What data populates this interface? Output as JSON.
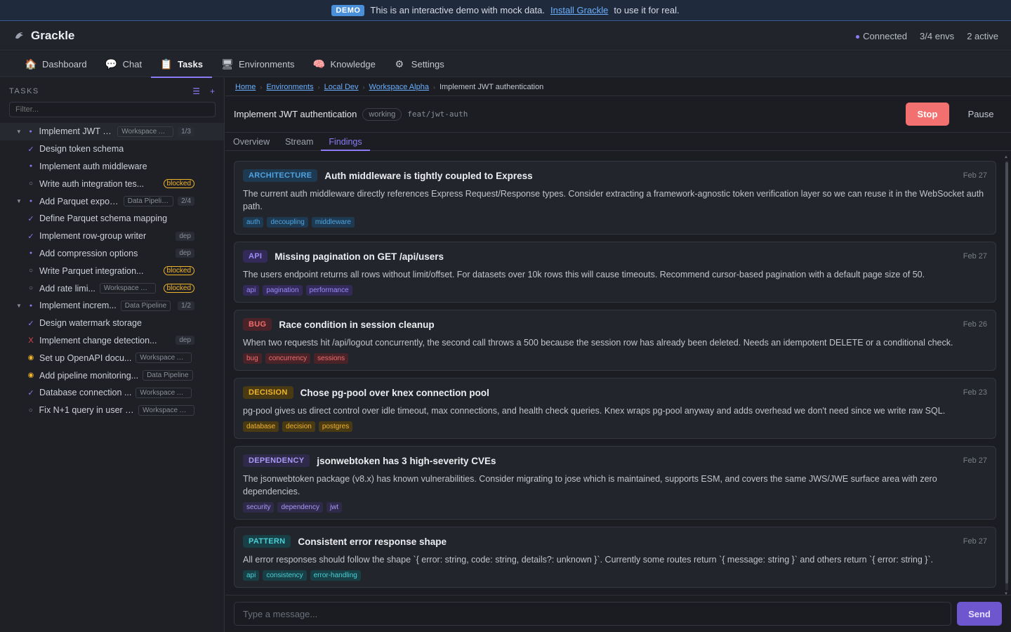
{
  "banner": {
    "badge": "DEMO",
    "text": "This is an interactive demo with mock data.",
    "link": "Install Grackle",
    "suffix": "to use it for real."
  },
  "header": {
    "app_name": "Grackle",
    "status": "Connected",
    "envs": "3/4 envs",
    "active": "2 active"
  },
  "nav": [
    {
      "label": "Dashboard",
      "icon": "house-icon",
      "glyph": "🏠"
    },
    {
      "label": "Chat",
      "icon": "chat-bubble-icon",
      "glyph": "💬"
    },
    {
      "label": "Tasks",
      "icon": "clipboard-icon",
      "glyph": "📋"
    },
    {
      "label": "Environments",
      "icon": "monitor-icon",
      "glyph": "🖥"
    },
    {
      "label": "Knowledge",
      "icon": "brain-icon",
      "glyph": "🧠"
    },
    {
      "label": "Settings",
      "icon": "gear-icon",
      "glyph": "⚙"
    }
  ],
  "sidebar": {
    "title": "TASKS",
    "filter_placeholder": "Filter...",
    "tasks": [
      {
        "label": "Implement JWT a...",
        "tag": "Workspace Al...",
        "count": "1/3",
        "status": "dot",
        "level": 0,
        "expanded": true,
        "selected": true
      },
      {
        "label": "Design token schema",
        "status": "check",
        "level": 1
      },
      {
        "label": "Implement auth middleware",
        "status": "dot",
        "level": 1
      },
      {
        "label": "Write auth integration tes...",
        "status": "circle",
        "level": 1,
        "blocked": "blocked"
      },
      {
        "label": "Add Parquet expor...",
        "tag": "Data Pipeline",
        "count": "2/4",
        "status": "dot",
        "level": 0,
        "expanded": true
      },
      {
        "label": "Define Parquet schema mapping",
        "status": "check",
        "level": 1
      },
      {
        "label": "Implement row-group writer",
        "status": "check",
        "level": 1,
        "dep": "dep"
      },
      {
        "label": "Add compression options",
        "status": "dot",
        "level": 1,
        "dep": "dep"
      },
      {
        "label": "Write Parquet integration...",
        "status": "circle",
        "level": 1,
        "blocked": "blocked"
      },
      {
        "label": "Add rate limi...",
        "tag": "Workspace Al...",
        "status": "circle",
        "level": 0,
        "blocked": "blocked"
      },
      {
        "label": "Implement increm...",
        "tag": "Data Pipeline",
        "count": "1/2",
        "status": "dot",
        "level": 0,
        "expanded": true
      },
      {
        "label": "Design watermark storage",
        "status": "check",
        "level": 1
      },
      {
        "label": "Implement change detection...",
        "status": "fail",
        "level": 1,
        "dep": "dep"
      },
      {
        "label": "Set up OpenAPI docu...",
        "tag": "Workspace Al...",
        "status": "warn",
        "level": 0
      },
      {
        "label": "Add pipeline monitoring...",
        "tag": "Data Pipeline",
        "status": "warn",
        "level": 0
      },
      {
        "label": "Database connection ...",
        "tag": "Workspace Al...",
        "status": "check",
        "level": 0
      },
      {
        "label": "Fix N+1 query in user li...",
        "tag": "Workspace Al...",
        "status": "circle",
        "level": 0
      }
    ]
  },
  "breadcrumbs": [
    "Home",
    "Environments",
    "Local Dev",
    "Workspace Alpha"
  ],
  "breadcrumb_current": "Implement JWT authentication",
  "task": {
    "title": "Implement JWT authentication",
    "state": "working",
    "branch": "feat/jwt-auth",
    "stop_label": "Stop",
    "pause_label": "Pause"
  },
  "subtabs": [
    "Overview",
    "Stream",
    "Findings"
  ],
  "findings": [
    {
      "category": "ARCHITECTURE",
      "color": "#4fa3e0",
      "bg": "#1e3a52",
      "title": "Auth middleware is tightly coupled to Express",
      "date": "Feb 27",
      "body": "The current auth middleware directly references Express Request/Response types. Consider extracting a framework-agnostic token verification layer so we can reuse it in the WebSocket auth path.",
      "tags": [
        "auth",
        "decoupling",
        "middleware"
      ]
    },
    {
      "category": "API",
      "color": "#9b8cf7",
      "bg": "#332a5a",
      "title": "Missing pagination on GET /api/users",
      "date": "Feb 27",
      "body": "The users endpoint returns all rows without limit/offset. For datasets over 10k rows this will cause timeouts. Recommend cursor-based pagination with a default page size of 50.",
      "tags": [
        "api",
        "pagination",
        "performance"
      ]
    },
    {
      "category": "BUG",
      "color": "#f06d6d",
      "bg": "#4a2328",
      "title": "Race condition in session cleanup",
      "date": "Feb 26",
      "body": "When two requests hit /api/logout concurrently, the second call throws a 500 because the session row has already been deleted. Needs an idempotent DELETE or a conditional check.",
      "tags": [
        "bug",
        "concurrency",
        "sessions"
      ]
    },
    {
      "category": "DECISION",
      "color": "#f0b429",
      "bg": "#4a3a14",
      "title": "Chose pg-pool over knex connection pool",
      "date": "Feb 23",
      "body": "pg-pool gives us direct control over idle timeout, max connections, and health check queries. Knex wraps pg-pool anyway and adds overhead we don't need since we write raw SQL.",
      "tags": [
        "database",
        "decision",
        "postgres"
      ]
    },
    {
      "category": "DEPENDENCY",
      "color": "#a899f7",
      "bg": "#2f2a4a",
      "title": "jsonwebtoken has 3 high-severity CVEs",
      "date": "Feb 27",
      "body": "The jsonwebtoken package (v8.x) has known vulnerabilities. Consider migrating to jose which is maintained, supports ESM, and covers the same JWS/JWE surface area with zero dependencies.",
      "tags": [
        "security",
        "dependency",
        "jwt"
      ]
    },
    {
      "category": "PATTERN",
      "color": "#4ad0d6",
      "bg": "#173f45",
      "title": "Consistent error response shape",
      "date": "Feb 27",
      "body": "All error responses should follow the shape `{ error: string, code: string, details?: unknown }`. Currently some routes return `{ message: string }` and others return `{ error: string }`.",
      "tags": [
        "api",
        "consistency",
        "error-handling"
      ]
    }
  ],
  "composer": {
    "placeholder": "Type a message...",
    "send_label": "Send"
  }
}
